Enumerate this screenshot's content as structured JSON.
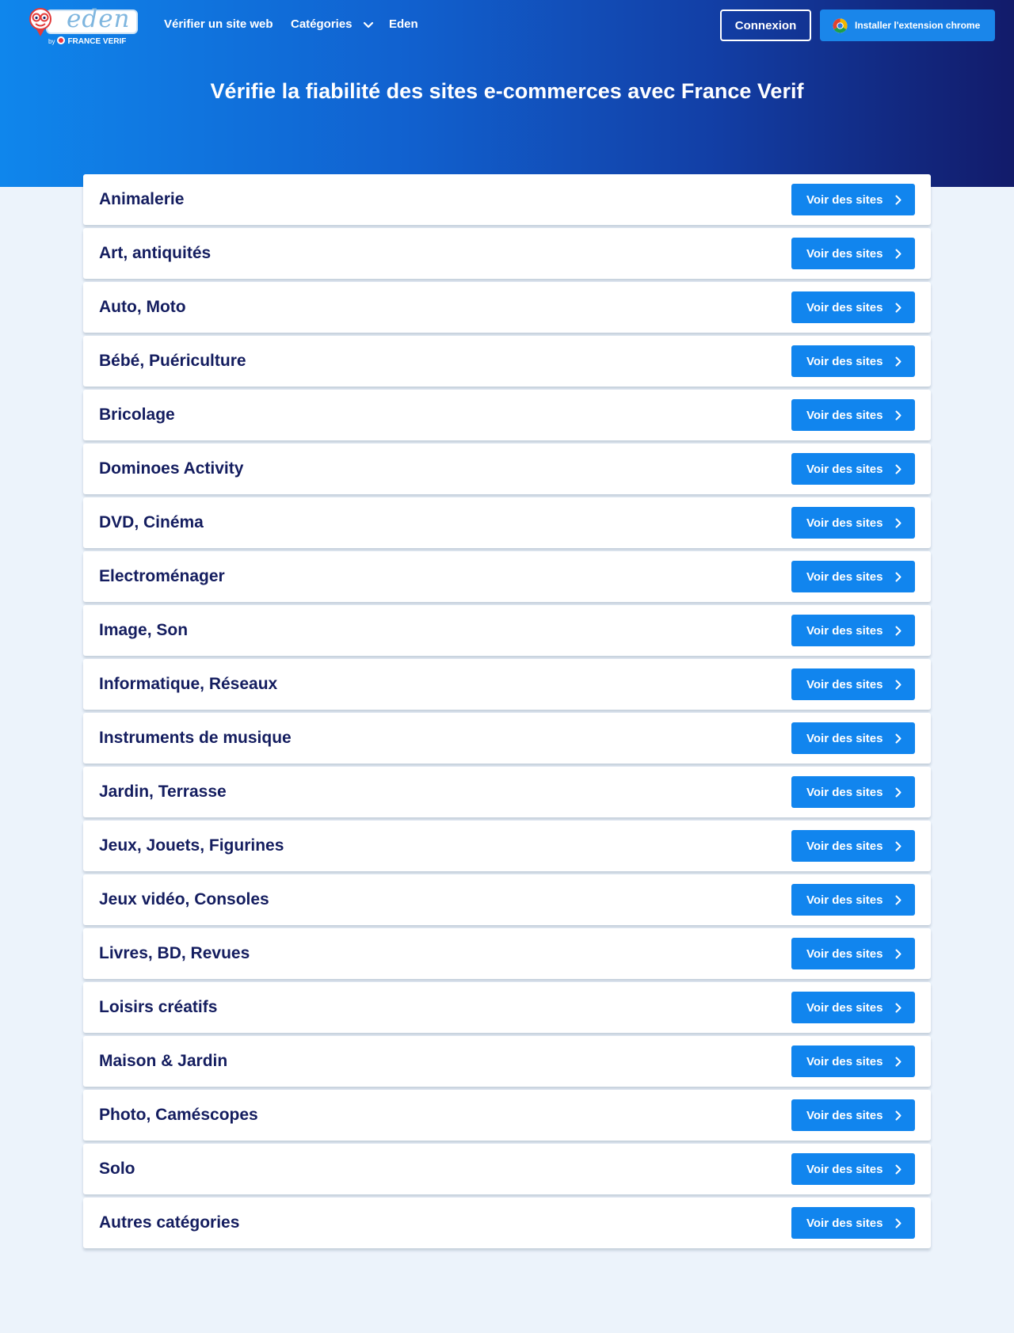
{
  "header": {
    "logo": {
      "word": "eden",
      "by": "by",
      "brand": "FRANCE VERIF"
    },
    "nav": {
      "verify": "Vérifier un site web",
      "categories": "Catégories",
      "eden": "Eden"
    },
    "login_label": "Connexion",
    "chrome_label": "Installer l'extension chrome"
  },
  "hero": {
    "title": "Vérifie la fiabilité des sites e-commerces avec France Verif"
  },
  "categories": {
    "button_label": "Voir des sites",
    "items": [
      "Animalerie",
      "Art, antiquités",
      "Auto, Moto",
      "Bébé, Puériculture",
      "Bricolage",
      "Dominoes Activity",
      "DVD, Cinéma",
      "Electroménager",
      "Image, Son",
      "Informatique, Réseaux",
      "Instruments de musique",
      "Jardin, Terrasse",
      "Jeux, Jouets, Figurines",
      "Jeux vidéo, Consoles",
      "Livres, BD, Revues",
      "Loisirs créatifs",
      "Maison & Jardin",
      "Photo, Caméscopes",
      "Solo",
      "Autres catégories"
    ]
  },
  "colors": {
    "accent": "#1185ee",
    "heading_text": "#141d5f",
    "page_background": "#ecf3fb",
    "hero_gradient_start": "#0f86ec",
    "hero_gradient_end": "#121b6a"
  },
  "icons": {
    "mascot": "mascot-icon",
    "chevron": "chevron-down-icon",
    "chrome": "chrome-icon",
    "arrow": "chevron-right-icon"
  }
}
